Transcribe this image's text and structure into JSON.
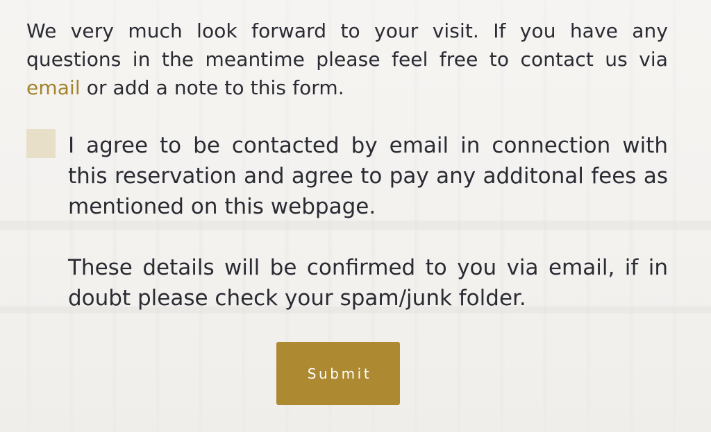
{
  "intro": {
    "before_link": "We very much look forward to your visit. If you have any questions in the meantime please feel free to contact us via ",
    "link_text": "email",
    "after_link": " or add a note to this form."
  },
  "consent": {
    "checked": false,
    "label": "I agree to be contacted by email in connection with this reservation and agree to pay any additonal fees as mentioned on this webpage."
  },
  "confirmation": {
    "text": "These details will be confirmed to you via email, if in doubt please check your spam/junk folder."
  },
  "submit": {
    "label": "Submit"
  },
  "colors": {
    "accent": "#ad8a31",
    "link": "#a4832d",
    "checkbox_fill": "#e8dfc8",
    "text": "#2a2b33"
  }
}
